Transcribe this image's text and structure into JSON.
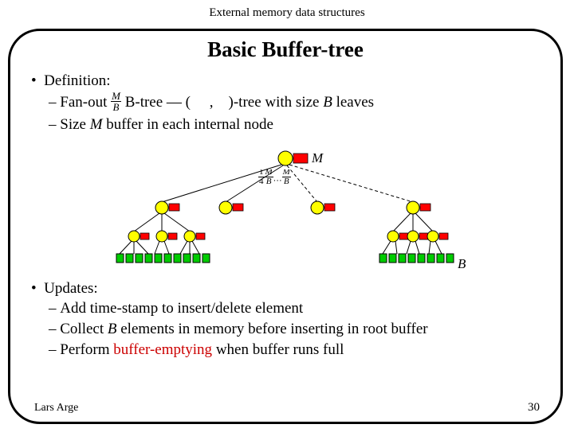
{
  "course": "External memory data structures",
  "title": "Basic Buffer-tree",
  "def": {
    "head": "Definition:",
    "line1_a": "Fan-out",
    "line1_b": "B-tree — (",
    "line1_c": ",",
    "line1_d": ")-tree with size",
    "line1_e": "leaves",
    "line2_a": "Size",
    "line2_b": "buffer in each internal node"
  },
  "upd": {
    "head": "Updates:",
    "line1": "Add time-stamp to insert/delete element",
    "line2_a": "Collect",
    "line2_b": "elements in memory before inserting in root buffer",
    "line3_a": "Perform",
    "line3_em": "buffer-emptying",
    "line3_b": "when buffer runs full"
  },
  "sym": {
    "B": "B",
    "M": "M"
  },
  "tree_labels": {
    "root_buf": "M",
    "leaf_label": "B"
  },
  "footer": {
    "author": "Lars Arge",
    "page": "30"
  }
}
